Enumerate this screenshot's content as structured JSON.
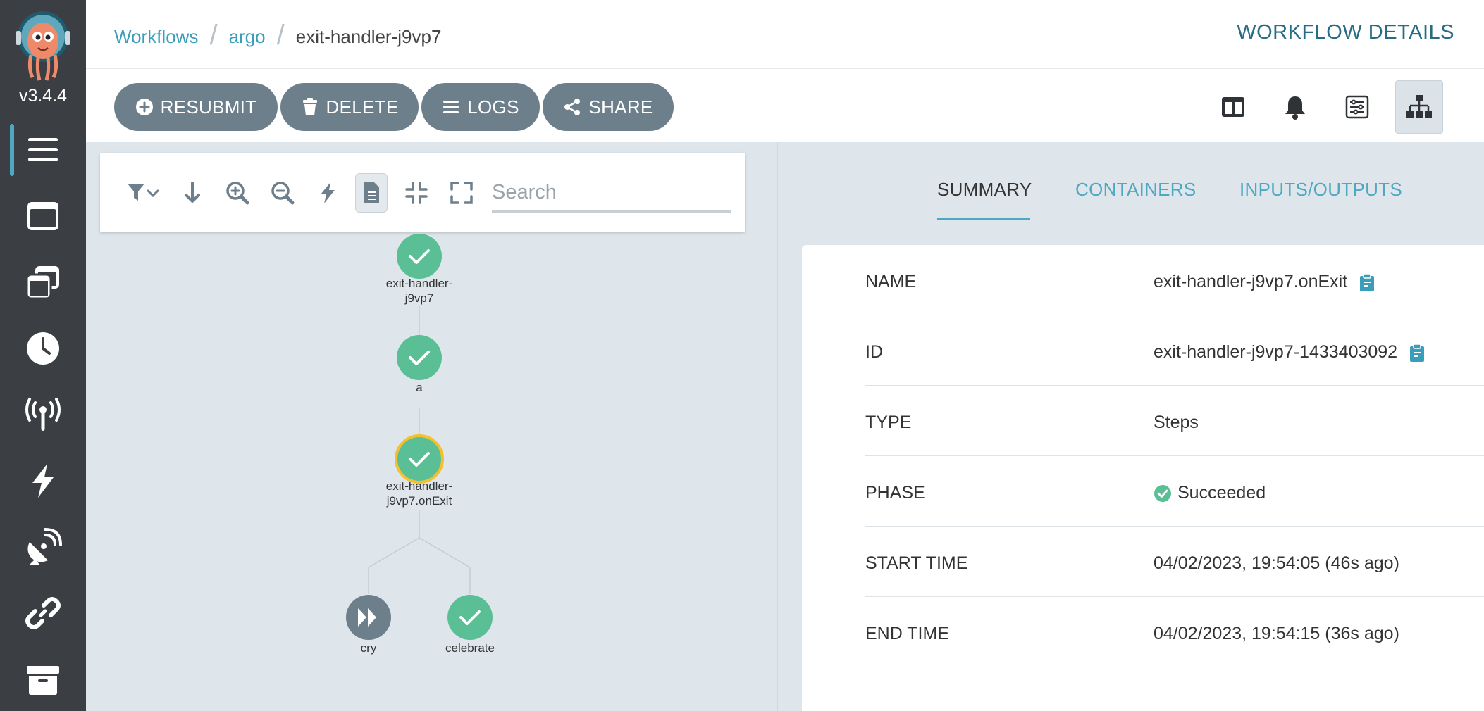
{
  "app": {
    "version": "v3.4.4"
  },
  "sidebar": {
    "items": [
      {
        "name": "workflows",
        "icon": "bars-icon"
      },
      {
        "name": "workflow-templates",
        "icon": "window-icon"
      },
      {
        "name": "cluster-workflow-templates",
        "icon": "clone-icon"
      },
      {
        "name": "cron-workflows",
        "icon": "clock-icon"
      },
      {
        "name": "event-sources",
        "icon": "broadcast-tower-icon"
      },
      {
        "name": "sensors",
        "icon": "bolt-icon"
      },
      {
        "name": "event-flow",
        "icon": "satellite-dish-icon"
      },
      {
        "name": "api-docs",
        "icon": "link-icon"
      },
      {
        "name": "archived",
        "icon": "archive-icon"
      }
    ]
  },
  "header": {
    "breadcrumb": [
      "Workflows",
      "argo",
      "exit-handler-j9vp7"
    ],
    "title": "WORKFLOW DETAILS"
  },
  "toolbar": {
    "resubmit": "RESUBMIT",
    "delete": "DELETE",
    "logs": "LOGS",
    "share": "SHARE"
  },
  "graph_toolbar": {
    "search_placeholder": "Search"
  },
  "graph": {
    "nodes": [
      {
        "id": "root",
        "label_lines": [
          "exit-handler-",
          "j9vp7"
        ],
        "status": "succeeded"
      },
      {
        "id": "a",
        "label_lines": [
          "a"
        ],
        "status": "succeeded"
      },
      {
        "id": "onexit",
        "label_lines": [
          "exit-handler-",
          "j9vp7.onExit"
        ],
        "status": "succeeded",
        "selected": true
      },
      {
        "id": "cry",
        "label_lines": [
          "cry"
        ],
        "status": "skipped"
      },
      {
        "id": "celebrate",
        "label_lines": [
          "celebrate"
        ],
        "status": "succeeded"
      }
    ]
  },
  "details": {
    "tabs": [
      "SUMMARY",
      "CONTAINERS",
      "INPUTS/OUTPUTS"
    ],
    "active_tab": "SUMMARY",
    "rows": [
      {
        "label": "NAME",
        "value": "exit-handler-j9vp7.onExit",
        "copy": true
      },
      {
        "label": "ID",
        "value": "exit-handler-j9vp7-1433403092",
        "copy": true
      },
      {
        "label": "TYPE",
        "value": "Steps"
      },
      {
        "label": "PHASE",
        "value": "Succeeded",
        "status_icon": true
      },
      {
        "label": "START TIME",
        "value": "04/02/2023, 19:54:05 (46s ago)"
      },
      {
        "label": "END TIME",
        "value": "04/02/2023, 19:54:15 (36s ago)"
      }
    ]
  },
  "colors": {
    "accent": "#4fa8c2",
    "success": "#5bbf95",
    "skipped": "#6e7f8c",
    "selected_ring": "#f4c030",
    "sidebar_bg": "#3b3e42"
  }
}
